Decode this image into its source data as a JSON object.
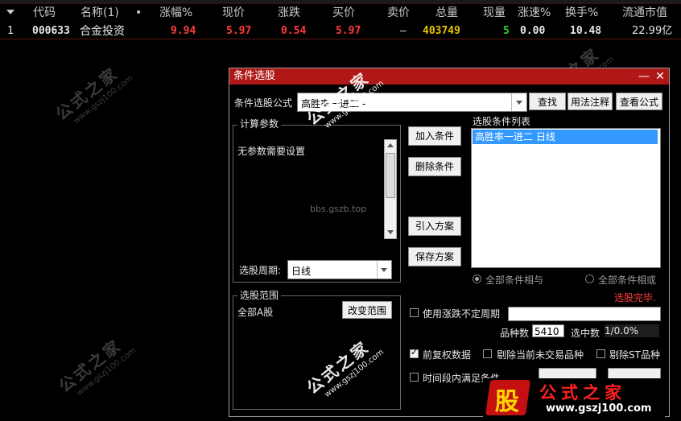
{
  "grid": {
    "headers": [
      "代码",
      "名称(1)",
      "•",
      "涨幅%",
      "现价",
      "涨跌",
      "买价",
      "卖价",
      "总量",
      "现量",
      "涨速%",
      "换手%",
      "流通市值"
    ],
    "row": {
      "index": "1",
      "code": "000633",
      "name": "合金投资",
      "pct_change": "9.94",
      "price": "5.97",
      "change": "0.54",
      "bid": "5.97",
      "ask": "–",
      "volume": "403749",
      "last_vol": "5",
      "speed": "0.00",
      "turnover": "10.48",
      "float_mv": "22.99亿"
    },
    "colors": {
      "up": "#ff3b3b",
      "volume": "#e6c300",
      "lastvol": "#33cc33",
      "neutral": "#e6e6e6"
    }
  },
  "watermark": {
    "text": "公式之家",
    "url": "www.gszj100.com",
    "forum": "bbs.gszb.top"
  },
  "dialog": {
    "title": "条件选股",
    "min_label": "—",
    "close_label": "✕",
    "formula_label": "条件选股公式",
    "formula_value": "高胜率一进二  -",
    "find_button": "查找",
    "usage_button": "用法注释",
    "view_button": "查看公式",
    "params_group": "计算参数",
    "params_text": "无参数需要设置",
    "add_condition": "加入条件",
    "delete_condition": "删除条件",
    "import_plan": "引入方案",
    "save_plan": "保存方案",
    "list_label": "选股条件列表",
    "list_items": [
      "高胜率一进二  日线"
    ],
    "period_label": "选股周期:",
    "period_value": "日线",
    "radio_and": "全部条件相与",
    "radio_or": "全部条件相或",
    "status": "选股完毕.",
    "range_group": "选股范围",
    "range_value": "全部A股",
    "change_range": "改变范围",
    "chk_uncertain": "使用涨跌不定周期",
    "count_label": "品种数",
    "count_value": "5410",
    "selected_label": "选中数",
    "selected_value": "1/0.0%",
    "chk_rights": "前复权数据",
    "chk_remove_new": "剔除当前未交易品种",
    "chk_remove_st": "剔除ST品种",
    "chk_period": "时间段内满足条件"
  },
  "logo": {
    "badge": "股",
    "name": "公式之家",
    "url": "www.gszj100.com"
  }
}
